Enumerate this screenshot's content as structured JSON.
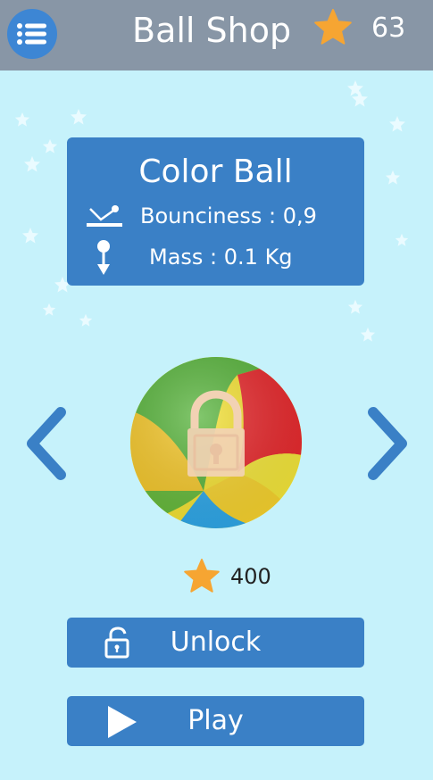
{
  "header": {
    "title": "Ball Shop",
    "star_count": "63",
    "menu_icon": "menu-list-icon"
  },
  "ball_info": {
    "name": "Color Ball",
    "bounciness": "Bounciness : 0,9",
    "mass": "Mass : 0.1 Kg"
  },
  "price": "400",
  "buttons": {
    "unlock": "Unlock",
    "play": "Play"
  },
  "colors": {
    "background": "#c6f2fb",
    "header": "#8896a6",
    "panel": "#3a80c6",
    "star": "#f6a532"
  },
  "locked": true
}
